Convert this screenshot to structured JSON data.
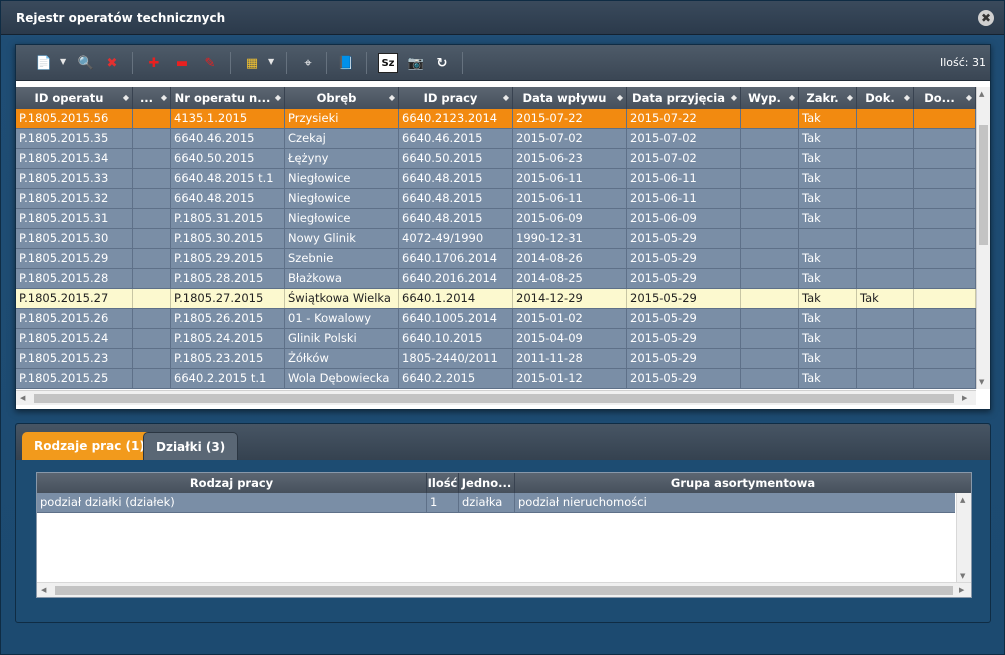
{
  "window": {
    "title": "Rejestr operatów technicznych",
    "close_glyph": "✖"
  },
  "toolbar": {
    "count_label": "Ilość: 31",
    "buttons": [
      {
        "name": "add-document-icon",
        "glyph": "📄"
      },
      {
        "name": "search-document-icon",
        "glyph": "🔍"
      },
      {
        "name": "delete-document-icon",
        "glyph": "✖"
      },
      {
        "name": "add-red-icon",
        "glyph": "✚"
      },
      {
        "name": "remove-red-icon",
        "glyph": "▬"
      },
      {
        "name": "edit-red-icon",
        "glyph": "✎"
      },
      {
        "name": "color-palette-icon",
        "glyph": "▦"
      },
      {
        "name": "binoculars-icon",
        "glyph": "⌖"
      },
      {
        "name": "book-icon",
        "glyph": "📘"
      },
      {
        "name": "sz-icon",
        "glyph": "Sz"
      },
      {
        "name": "camera-icon",
        "glyph": "📷"
      },
      {
        "name": "refresh-icon",
        "glyph": "↻"
      }
    ]
  },
  "grid": {
    "columns": [
      "ID operatu",
      "...",
      "Nr operatu n...",
      "Obręb",
      "ID pracy",
      "Data wpływu",
      "Data przyjęcia",
      "Wyp.",
      "Zakr.",
      "Dok.",
      "Do..."
    ],
    "rows": [
      {
        "state": "selected",
        "cells": [
          "P.1805.2015.56",
          "",
          "4135.1.2015",
          "Przysieki",
          "6640.2123.2014",
          "2015-07-22",
          "2015-07-22",
          "",
          "Tak",
          "",
          ""
        ]
      },
      {
        "state": "normal",
        "cells": [
          "P.1805.2015.35",
          "",
          "6640.46.2015",
          "Czekaj",
          "6640.46.2015",
          "2015-07-02",
          "2015-07-02",
          "",
          "Tak",
          "",
          ""
        ]
      },
      {
        "state": "normal",
        "cells": [
          "P.1805.2015.34",
          "",
          "6640.50.2015",
          "Łężyny",
          "6640.50.2015",
          "2015-06-23",
          "2015-07-02",
          "",
          "Tak",
          "",
          ""
        ]
      },
      {
        "state": "normal",
        "cells": [
          "P.1805.2015.33",
          "",
          "6640.48.2015 t.1",
          "Niegłowice",
          "6640.48.2015",
          "2015-06-11",
          "2015-06-11",
          "",
          "Tak",
          "",
          ""
        ]
      },
      {
        "state": "normal",
        "cells": [
          "P.1805.2015.32",
          "",
          "6640.48.2015",
          "Niegłowice",
          "6640.48.2015",
          "2015-06-11",
          "2015-06-11",
          "",
          "Tak",
          "",
          ""
        ]
      },
      {
        "state": "normal",
        "cells": [
          "P.1805.2015.31",
          "",
          "P.1805.31.2015",
          "Niegłowice",
          "6640.48.2015",
          "2015-06-09",
          "2015-06-09",
          "",
          "Tak",
          "",
          ""
        ]
      },
      {
        "state": "normal",
        "cells": [
          "P.1805.2015.30",
          "",
          "P.1805.30.2015",
          "Nowy Glinik",
          "4072-49/1990",
          "1990-12-31",
          "2015-05-29",
          "",
          "",
          "",
          ""
        ]
      },
      {
        "state": "normal",
        "cells": [
          "P.1805.2015.29",
          "",
          "P.1805.29.2015",
          "Szebnie",
          "6640.1706.2014",
          "2014-08-26",
          "2015-05-29",
          "",
          "Tak",
          "",
          ""
        ]
      },
      {
        "state": "normal",
        "cells": [
          "P.1805.2015.28",
          "",
          "P.1805.28.2015",
          "Błażkowa",
          "6640.2016.2014",
          "2014-08-25",
          "2015-05-29",
          "",
          "Tak",
          "",
          ""
        ]
      },
      {
        "state": "hover",
        "cells": [
          "P.1805.2015.27",
          "",
          "P.1805.27.2015",
          "Świątkowa Wielka",
          "6640.1.2014",
          "2014-12-29",
          "2015-05-29",
          "",
          "Tak",
          "Tak",
          ""
        ]
      },
      {
        "state": "normal",
        "cells": [
          "P.1805.2015.26",
          "",
          "P.1805.26.2015",
          "01 - Kowalowy",
          "6640.1005.2014",
          "2015-01-02",
          "2015-05-29",
          "",
          "Tak",
          "",
          ""
        ]
      },
      {
        "state": "normal",
        "cells": [
          "P.1805.2015.24",
          "",
          "P.1805.24.2015",
          "Glinik Polski",
          "6640.10.2015",
          "2015-04-09",
          "2015-05-29",
          "",
          "Tak",
          "",
          ""
        ]
      },
      {
        "state": "normal",
        "cells": [
          "P.1805.2015.23",
          "",
          "P.1805.23.2015",
          "Żółków",
          "1805-2440/2011",
          "2011-11-28",
          "2015-05-29",
          "",
          "Tak",
          "",
          ""
        ]
      },
      {
        "state": "normal",
        "cells": [
          "P.1805.2015.25",
          "",
          "6640.2.2015 t.1",
          "Wola Dębowiecka",
          "6640.2.2015",
          "2015-01-12",
          "2015-05-29",
          "",
          "Tak",
          "",
          ""
        ]
      }
    ]
  },
  "tabs": [
    {
      "label": "Rodzaje prac (1)",
      "active": true
    },
    {
      "label": "Działki (3)",
      "active": false
    }
  ],
  "subgrid": {
    "columns": [
      "Rodzaj pracy",
      "Ilość",
      "Jedno...",
      "Grupa asortymentowa"
    ],
    "rows": [
      [
        "podział działki (działek)",
        "1",
        "działka",
        "podział nieruchomości"
      ]
    ]
  }
}
